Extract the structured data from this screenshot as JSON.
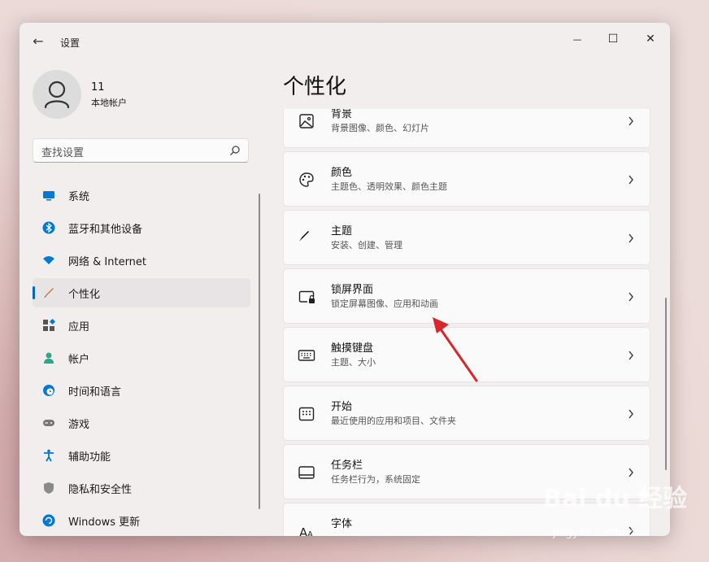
{
  "window": {
    "title": "设置",
    "back_glyph": "←",
    "min_glyph": "—",
    "max_glyph": "☐",
    "close_glyph": "✕"
  },
  "user": {
    "name": "11",
    "account_type": "本地帐户"
  },
  "search": {
    "placeholder": "查找设置"
  },
  "nav": [
    {
      "label": "系统",
      "icon": "monitor-icon",
      "color": "#0078d4"
    },
    {
      "label": "蓝牙和其他设备",
      "icon": "bluetooth-icon",
      "color": "#0078d4"
    },
    {
      "label": "网络 & Internet",
      "icon": "wifi-icon",
      "color": "#0078d4"
    },
    {
      "label": "个性化",
      "icon": "brush-icon",
      "color": "#c77a3a",
      "active": true
    },
    {
      "label": "应用",
      "icon": "apps-icon",
      "color": "#555555"
    },
    {
      "label": "帐户",
      "icon": "person-icon",
      "color": "#2fa58a"
    },
    {
      "label": "时间和语言",
      "icon": "globe-clock-icon",
      "color": "#0078d4"
    },
    {
      "label": "游戏",
      "icon": "gamepad-icon",
      "color": "#777777"
    },
    {
      "label": "辅助功能",
      "icon": "accessibility-icon",
      "color": "#0078d4"
    },
    {
      "label": "隐私和安全性",
      "icon": "shield-icon",
      "color": "#8a8a8a"
    },
    {
      "label": "Windows 更新",
      "icon": "update-icon",
      "color": "#0078d4"
    }
  ],
  "page": {
    "title": "个性化"
  },
  "cards": [
    {
      "title": "背景",
      "subtitle": "背景图像、颜色、幻灯片",
      "icon": "image-icon"
    },
    {
      "title": "颜色",
      "subtitle": "主题色、透明效果、颜色主题",
      "icon": "palette-icon"
    },
    {
      "title": "主题",
      "subtitle": "安装、创建、管理",
      "icon": "brush-icon"
    },
    {
      "title": "锁屏界面",
      "subtitle": "锁定屏幕图像、应用和动画",
      "icon": "lock-screen-icon"
    },
    {
      "title": "触摸键盘",
      "subtitle": "主题、大小",
      "icon": "keyboard-icon"
    },
    {
      "title": "开始",
      "subtitle": "最近使用的应用和项目、文件夹",
      "icon": "start-icon"
    },
    {
      "title": "任务栏",
      "subtitle": "任务栏行为，系统固定",
      "icon": "taskbar-icon"
    },
    {
      "title": "字体",
      "subtitle": "",
      "icon": "font-icon"
    }
  ],
  "watermark": {
    "logo": "Bai du 经验",
    "url": "jingyan.baidu.com"
  }
}
